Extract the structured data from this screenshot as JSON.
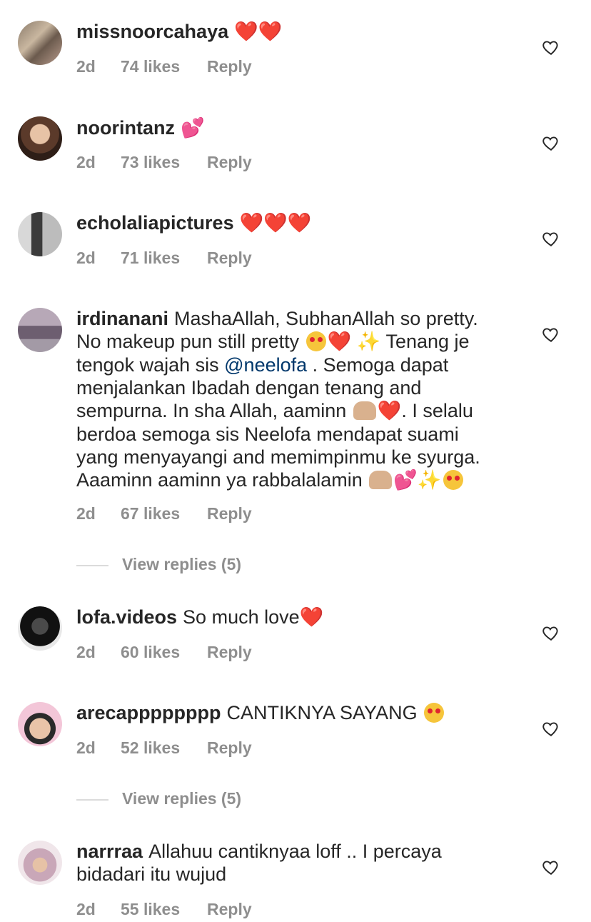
{
  "comments": [
    {
      "username": "missnoorcahaya",
      "text": "",
      "emoji": "❤️❤️",
      "time": "2d",
      "likes": "74 likes",
      "reply": "Reply"
    },
    {
      "username": "noorintanz",
      "text": "",
      "emoji": "💕",
      "time": "2d",
      "likes": "73 likes",
      "reply": "Reply"
    },
    {
      "username": "echolaliapictures",
      "text": "",
      "emoji": "❤️❤️❤️",
      "time": "2d",
      "likes": "71 likes",
      "reply": "Reply"
    },
    {
      "username": "irdinanani",
      "text_1": "MashaAllah, SubhanAllah so pretty. No makeup pun still pretty",
      "text_2": "Tenang je tengok wajah sis",
      "mention": "@neelofa",
      "text_3": ". Semoga dapat menjalankan Ibadah dengan tenang and sempurna. In sha Allah, aaminn",
      "text_4": ". I selalu berdoa semoga sis Neelofa mendapat suami yang menyayangi and memimpinmu ke syurga. Aaaminn aaminn ya rabbalalamin",
      "time": "2d",
      "likes": "67 likes",
      "reply": "Reply",
      "view_replies": "View replies (5)"
    },
    {
      "username": "lofa.videos",
      "text": "So much love",
      "time": "2d",
      "likes": "60 likes",
      "reply": "Reply"
    },
    {
      "username": "arecapppppppp",
      "text": "CANTIKNYA SAYANG",
      "time": "2d",
      "likes": "52 likes",
      "reply": "Reply",
      "view_replies": "View replies (5)"
    },
    {
      "username": "narrraa",
      "text": "Allahuu cantiknyaa loff .. I percaya bidadari itu wujud",
      "time": "2d",
      "likes": "55 likes",
      "reply": "Reply"
    }
  ],
  "icons": {
    "like": "heart-outline-icon"
  },
  "colors": {
    "text": "#262626",
    "meta": "#8e8e8e",
    "mention": "#00376b",
    "heart": "#e0242f"
  }
}
